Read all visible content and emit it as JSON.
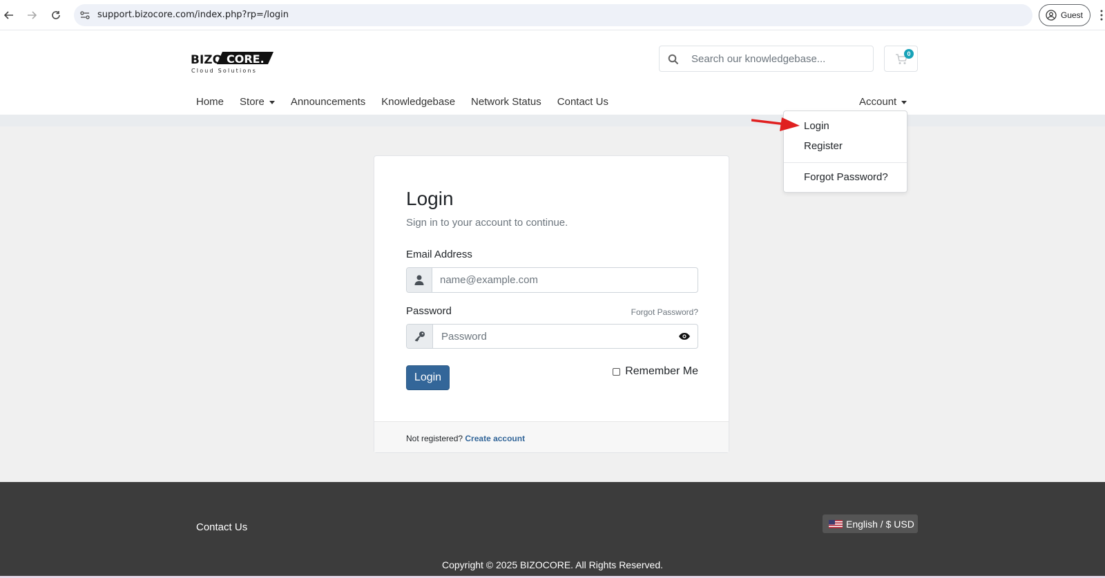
{
  "browser": {
    "url": "support.bizocore.com/index.php?rp=/login",
    "profile_label": "Guest"
  },
  "header": {
    "logo_text": "BIZOCORE.",
    "logo_tagline": "Cloud Solutions",
    "search_placeholder": "Search our knowledgebase...",
    "cart_count": "0",
    "nav": {
      "home": "Home",
      "store": "Store",
      "announcements": "Announcements",
      "knowledgebase": "Knowledgebase",
      "network_status": "Network Status",
      "contact_us": "Contact Us",
      "account": "Account"
    }
  },
  "account_menu": {
    "login": "Login",
    "register": "Register",
    "forgot_password": "Forgot Password?"
  },
  "login_card": {
    "title": "Login",
    "subtitle": "Sign in to your account to continue.",
    "email_label": "Email Address",
    "email_placeholder": "name@example.com",
    "password_label": "Password",
    "forgot_link": "Forgot Password?",
    "password_placeholder": "Password",
    "login_button": "Login",
    "remember_me": "Remember Me",
    "remember_checked": false,
    "not_registered": "Not registered?",
    "create_account": "Create account"
  },
  "footer": {
    "contact_us": "Contact Us",
    "language_currency": "English / $ USD",
    "copyright": "Copyright © 2025 BIZOCORE. All Rights Reserved."
  },
  "colors": {
    "primary": "#336699",
    "badge": "#17a2b8",
    "footer_bg": "#3c3c3c",
    "annotation_arrow": "#e02020"
  }
}
